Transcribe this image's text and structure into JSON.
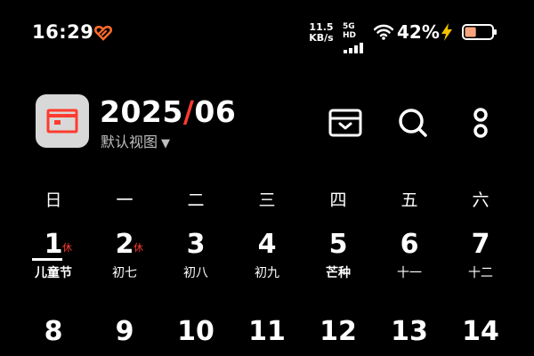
{
  "status_bar": {
    "time": "16:29",
    "net_speed_value": "11.5",
    "net_speed_unit": "KB/s",
    "network_type": "5G HD",
    "battery_percent": "42%",
    "battery_level": 0.42,
    "icons": [
      "heart-icon",
      "signal-icon",
      "wifi-icon",
      "bolt-icon",
      "battery-icon"
    ],
    "accent_color": "#ff6a2a"
  },
  "header": {
    "year": "2025",
    "separator": "/",
    "month": "06",
    "view_label": "默认视图",
    "caret": "▼",
    "icons": [
      "inbox-icon",
      "search-icon",
      "more-icon"
    ]
  },
  "calendar": {
    "weekdays": [
      "日",
      "一",
      "二",
      "三",
      "四",
      "五",
      "六"
    ],
    "rows": [
      [
        {
          "day": "1",
          "sub": "儿童节",
          "badge": "休",
          "highlight": true,
          "selected": true
        },
        {
          "day": "2",
          "sub": "初七",
          "badge": "休"
        },
        {
          "day": "3",
          "sub": "初八"
        },
        {
          "day": "4",
          "sub": "初九"
        },
        {
          "day": "5",
          "sub": "芒种",
          "highlight": true
        },
        {
          "day": "6",
          "sub": "十一"
        },
        {
          "day": "7",
          "sub": "十二"
        }
      ],
      [
        {
          "day": "8"
        },
        {
          "day": "9"
        },
        {
          "day": "10"
        },
        {
          "day": "11"
        },
        {
          "day": "12"
        },
        {
          "day": "13"
        },
        {
          "day": "14"
        }
      ]
    ],
    "holiday_color": "#ff3b30"
  }
}
